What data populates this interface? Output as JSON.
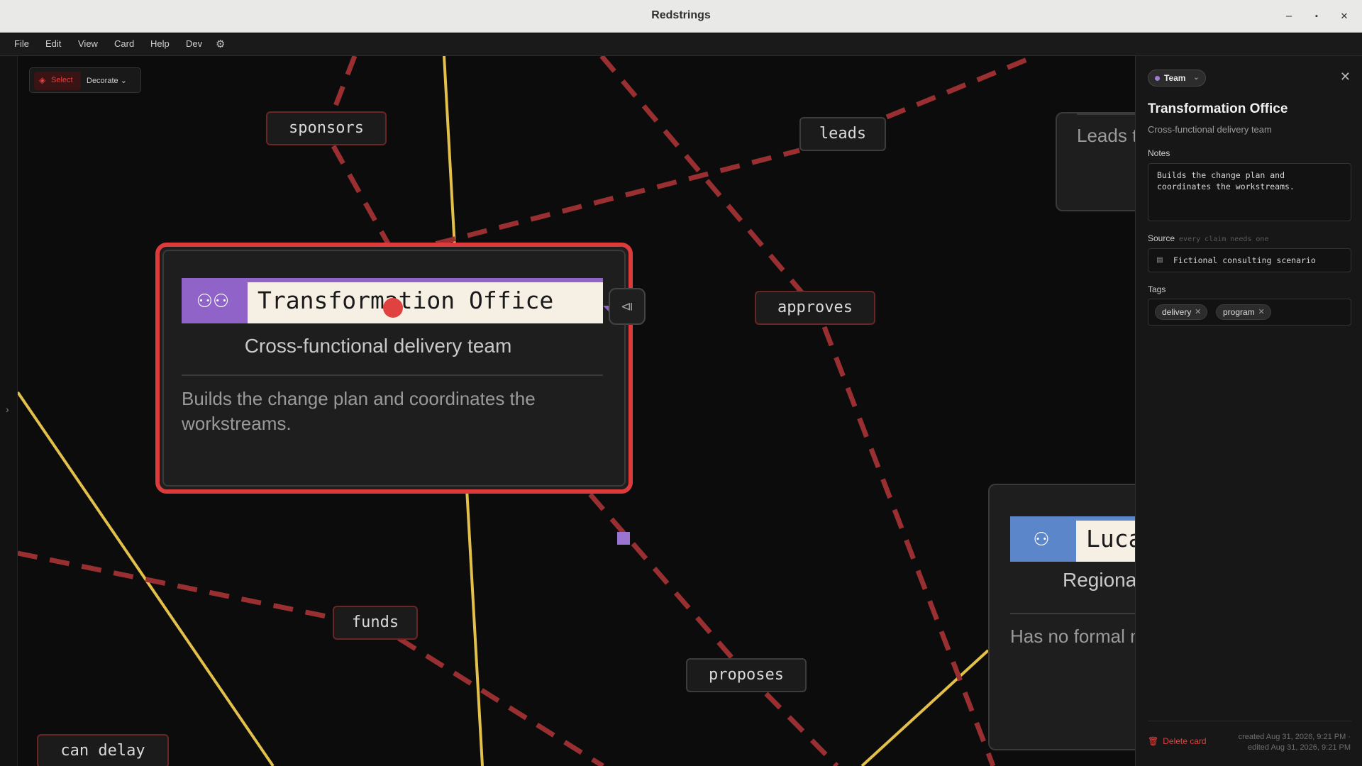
{
  "window": {
    "title": "Redstrings",
    "minimize": "–",
    "maximize": "▪",
    "close": "✕"
  },
  "menu": {
    "items": [
      "File",
      "Edit",
      "View",
      "Card",
      "Help",
      "Dev"
    ]
  },
  "toolbar": {
    "select_label": "Select",
    "decorate_label": "Decorate ⌄"
  },
  "edge_labels": {
    "sponsors": "sponsors",
    "leads": "leads",
    "approves": "approves",
    "funds": "funds",
    "proposes": "proposes",
    "can_delay": "can delay"
  },
  "main_node": {
    "title": "Transformation Office",
    "subtitle": "Cross-functional delivery team",
    "description": "Builds the change plan and coordinates the workstreams.",
    "color": "#9063c9",
    "icon": "people-icon"
  },
  "luca_node": {
    "title": "Luca",
    "subtitle": "Regiona",
    "description": "Has no formal managers follo",
    "color": "#5b86c9",
    "icon": "person-icon"
  },
  "top_node": {
    "description": "Leads t suppor"
  },
  "panel": {
    "type": "Team",
    "title": "Transformation Office",
    "subtitle": "Cross-functional delivery team",
    "notes_label": "Notes",
    "notes": "Builds the change plan and coordinates the workstreams.",
    "source_label": "Source",
    "source_hint": "every claim needs one",
    "source": "Fictional consulting scenario",
    "tags_label": "Tags",
    "tags": [
      "delivery",
      "program"
    ],
    "delete_label": "Delete card",
    "created": "created Aug 31, 2026, 9:21 PM ·",
    "edited": "edited Aug 31, 2026, 9:21 PM"
  },
  "colors": {
    "accent": "#e0423f",
    "edge_red": "#9a2f32",
    "edge_yellow": "#e2c04a"
  }
}
